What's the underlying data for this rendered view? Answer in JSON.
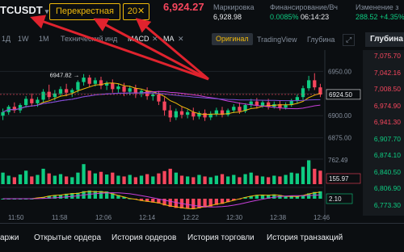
{
  "header": {
    "symbol": "TCUSDT",
    "margin_mode": "Перекрестная",
    "leverage": "20",
    "leverage_close": "✕",
    "last_price": "6,924.27",
    "mark_label": "Маркировка",
    "mark_value": "6,928.98",
    "funding_label": "Финансирование/Вч",
    "funding_rate": "0.0085%",
    "funding_time": "06:14:23",
    "change_label": "Изменение з",
    "change_value": "288.52 +4.35%"
  },
  "toolbar": {
    "items": [
      "1Д",
      "1W",
      "1M",
      "Технический инд",
      "MACD",
      "MA"
    ],
    "close_glyph": "✕",
    "tabs": [
      "Оригинал",
      "TradingView",
      "Глубина"
    ],
    "expand_icon": "expand-icon"
  },
  "orderbook": {
    "title": "Глубина",
    "prices": [
      "7,075.70",
      "7,042.16",
      "7,008.50",
      "6,974.90",
      "6,941.30",
      "6,907.70",
      "6,874.10",
      "6,840.50",
      "6,806.90",
      "6,773.30"
    ]
  },
  "chart_data": {
    "type": "candlestick",
    "x_ticks": [
      "11:50",
      "11:58",
      "12:06",
      "12:14",
      "12:22",
      "12:30",
      "12:38",
      "12:46"
    ],
    "y_ticks": [
      6950.0,
      6925.0,
      6900.0,
      6875.0
    ],
    "y_tick_labels": [
      "6950.00",
      "6925.00",
      "6900.00",
      "6875.00"
    ],
    "ylim": [
      6860,
      6965
    ],
    "current_price_label": "6924.50",
    "high_annotation": "6947.82",
    "volume_ticks": [
      "762.49"
    ],
    "volume_current": "155.97",
    "macd_current": "2.10",
    "candles": [
      {
        "o": 6900,
        "h": 6908,
        "c": 6904,
        "l": 6895
      },
      {
        "o": 6904,
        "h": 6912,
        "c": 6910,
        "l": 6901
      },
      {
        "o": 6910,
        "h": 6915,
        "c": 6906,
        "l": 6903
      },
      {
        "o": 6906,
        "h": 6914,
        "c": 6912,
        "l": 6903
      },
      {
        "o": 6912,
        "h": 6922,
        "c": 6919,
        "l": 6909
      },
      {
        "o": 6919,
        "h": 6925,
        "c": 6914,
        "l": 6911
      },
      {
        "o": 6914,
        "h": 6921,
        "c": 6918,
        "l": 6910
      },
      {
        "o": 6918,
        "h": 6930,
        "c": 6927,
        "l": 6915
      },
      {
        "o": 6927,
        "h": 6935,
        "c": 6921,
        "l": 6918
      },
      {
        "o": 6921,
        "h": 6929,
        "c": 6925,
        "l": 6917
      },
      {
        "o": 6925,
        "h": 6933,
        "c": 6930,
        "l": 6922
      },
      {
        "o": 6930,
        "h": 6936,
        "c": 6926,
        "l": 6922
      },
      {
        "o": 6926,
        "h": 6931,
        "c": 6929,
        "l": 6921
      },
      {
        "o": 6929,
        "h": 6940,
        "c": 6938,
        "l": 6926
      },
      {
        "o": 6938,
        "h": 6947,
        "c": 6943,
        "l": 6934
      },
      {
        "o": 6943,
        "h": 6946,
        "c": 6936,
        "l": 6932
      },
      {
        "o": 6936,
        "h": 6943,
        "c": 6940,
        "l": 6933
      },
      {
        "o": 6940,
        "h": 6944,
        "c": 6934,
        "l": 6930
      },
      {
        "o": 6934,
        "h": 6939,
        "c": 6937,
        "l": 6929
      },
      {
        "o": 6937,
        "h": 6941,
        "c": 6930,
        "l": 6926
      },
      {
        "o": 6930,
        "h": 6936,
        "c": 6933,
        "l": 6926
      },
      {
        "o": 6933,
        "h": 6937,
        "c": 6927,
        "l": 6922
      },
      {
        "o": 6927,
        "h": 6934,
        "c": 6931,
        "l": 6923
      },
      {
        "o": 6931,
        "h": 6935,
        "c": 6925,
        "l": 6920
      },
      {
        "o": 6925,
        "h": 6930,
        "c": 6928,
        "l": 6921
      },
      {
        "o": 6928,
        "h": 6932,
        "c": 6922,
        "l": 6918
      },
      {
        "o": 6922,
        "h": 6927,
        "c": 6924,
        "l": 6917
      },
      {
        "o": 6924,
        "h": 6928,
        "c": 6916,
        "l": 6912
      },
      {
        "o": 6916,
        "h": 6921,
        "c": 6906,
        "l": 6900
      },
      {
        "o": 6906,
        "h": 6912,
        "c": 6898,
        "l": 6893
      },
      {
        "o": 6898,
        "h": 6908,
        "c": 6905,
        "l": 6895
      },
      {
        "o": 6905,
        "h": 6910,
        "c": 6901,
        "l": 6897
      },
      {
        "o": 6901,
        "h": 6907,
        "c": 6904,
        "l": 6897
      },
      {
        "o": 6904,
        "h": 6909,
        "c": 6899,
        "l": 6895
      },
      {
        "o": 6899,
        "h": 6905,
        "c": 6903,
        "l": 6896
      },
      {
        "o": 6903,
        "h": 6907,
        "c": 6898,
        "l": 6894
      },
      {
        "o": 6898,
        "h": 6905,
        "c": 6902,
        "l": 6895
      },
      {
        "o": 6902,
        "h": 6909,
        "c": 6906,
        "l": 6899
      },
      {
        "o": 6906,
        "h": 6910,
        "c": 6901,
        "l": 6898
      },
      {
        "o": 6901,
        "h": 6908,
        "c": 6906,
        "l": 6899
      },
      {
        "o": 6906,
        "h": 6913,
        "c": 6910,
        "l": 6903
      },
      {
        "o": 6910,
        "h": 6915,
        "c": 6905,
        "l": 6902
      },
      {
        "o": 6905,
        "h": 6914,
        "c": 6912,
        "l": 6903
      },
      {
        "o": 6912,
        "h": 6919,
        "c": 6916,
        "l": 6909
      },
      {
        "o": 6916,
        "h": 6920,
        "c": 6911,
        "l": 6908
      },
      {
        "o": 6911,
        "h": 6917,
        "c": 6915,
        "l": 6909
      },
      {
        "o": 6915,
        "h": 6919,
        "c": 6910,
        "l": 6907
      },
      {
        "o": 6910,
        "h": 6916,
        "c": 6913,
        "l": 6908
      },
      {
        "o": 6913,
        "h": 6917,
        "c": 6909,
        "l": 6906
      },
      {
        "o": 6909,
        "h": 6915,
        "c": 6912,
        "l": 6907
      },
      {
        "o": 6912,
        "h": 6919,
        "c": 6917,
        "l": 6910
      },
      {
        "o": 6917,
        "h": 6924,
        "c": 6921,
        "l": 6914
      },
      {
        "o": 6921,
        "h": 6934,
        "c": 6931,
        "l": 6918
      },
      {
        "o": 6931,
        "h": 6945,
        "c": 6940,
        "l": 6928
      },
      {
        "o": 6940,
        "h": 6948,
        "c": 6932,
        "l": 6929
      },
      {
        "o": 6932,
        "h": 6936,
        "c": 6924,
        "l": 6921
      }
    ],
    "volumes": [
      30,
      22,
      18,
      25,
      35,
      20,
      24,
      40,
      28,
      22,
      26,
      20,
      18,
      30,
      52,
      35,
      28,
      32,
      25,
      30,
      22,
      20,
      24,
      18,
      22,
      26,
      20,
      28,
      34,
      40,
      30,
      22,
      20,
      18,
      24,
      20,
      18,
      22,
      26,
      20,
      24,
      18,
      26,
      30,
      22,
      20,
      18,
      22,
      20,
      24,
      30,
      28,
      45,
      62,
      40,
      35
    ]
  },
  "bottom_tabs": [
    "аржи",
    "Открытые ордера",
    "История ордеров",
    "История торговли",
    "История транзакций"
  ],
  "colors": {
    "up": "#0ecb81",
    "down": "#f6465d",
    "accent": "#f0b90b",
    "annotation_arrow": "#e0232e"
  }
}
